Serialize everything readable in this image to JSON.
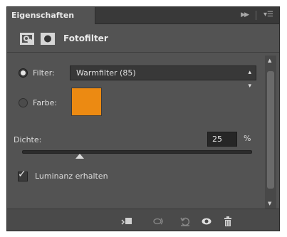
{
  "panel": {
    "tab_title": "Eigenschaften",
    "collapse_icon": "double-chevron-right-icon",
    "menu_icon": "panel-menu-icon"
  },
  "header": {
    "adjustment_icon": "adjustment-layer-icon",
    "mask_icon": "layer-mask-icon",
    "title": "Fotofilter"
  },
  "filter": {
    "label": "Filter:",
    "selected": true,
    "dropdown_value": "Warmfilter (85)"
  },
  "color": {
    "label": "Farbe:",
    "selected": false,
    "swatch_color": "#ec8a12"
  },
  "density": {
    "label": "Dichte:",
    "value": "25",
    "unit": "%",
    "slider_fraction": 0.25
  },
  "luminance": {
    "label": "Luminanz erhalten",
    "checked": true
  },
  "bottom_toolbar": {
    "icons": [
      "clip-to-layer-icon",
      "view-previous-state-icon",
      "reset-icon",
      "visibility-eye-icon",
      "trash-icon"
    ]
  },
  "colors": {
    "panel_bg": "#535353",
    "accent_orange": "#ec8a12"
  }
}
